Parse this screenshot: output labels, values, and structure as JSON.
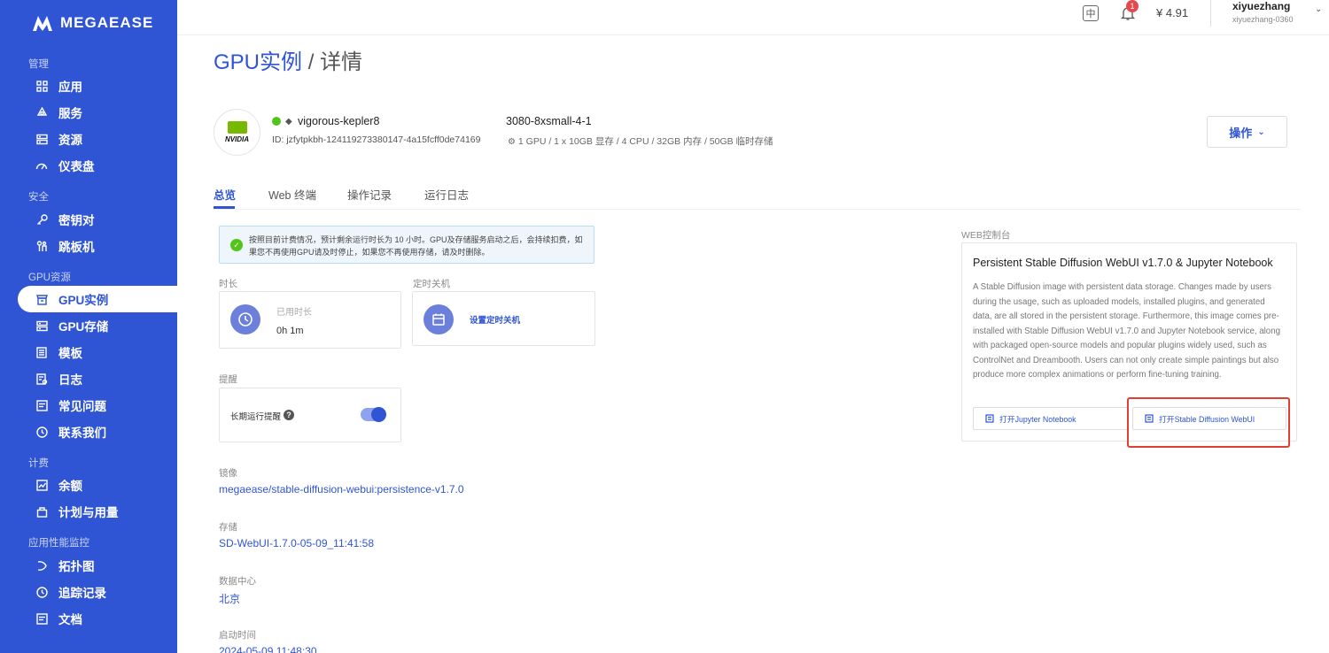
{
  "app": {
    "brand": "MEGAEASE"
  },
  "sidebar": {
    "sections": [
      {
        "title": "管理",
        "items": [
          {
            "label": "应用",
            "icon": "grid-icon"
          },
          {
            "label": "服务",
            "icon": "recycle-icon"
          },
          {
            "label": "资源",
            "icon": "server-icon"
          },
          {
            "label": "仪表盘",
            "icon": "gauge-icon"
          }
        ]
      },
      {
        "title": "安全",
        "items": [
          {
            "label": "密钥对",
            "icon": "key-icon"
          },
          {
            "label": "跳板机",
            "icon": "jump-icon"
          }
        ]
      },
      {
        "title": "GPU资源",
        "items": [
          {
            "label": "GPU实例",
            "icon": "gpu-icon",
            "active": true
          },
          {
            "label": "GPU存储",
            "icon": "storage-icon"
          },
          {
            "label": "模板",
            "icon": "template-icon"
          },
          {
            "label": "日志",
            "icon": "log-icon"
          },
          {
            "label": "常见问题",
            "icon": "faq-icon"
          },
          {
            "label": "联系我们",
            "icon": "clock-icon"
          }
        ]
      },
      {
        "title": "计费",
        "items": [
          {
            "label": "余额",
            "icon": "chart-icon"
          },
          {
            "label": "计划与用量",
            "icon": "bag-icon"
          }
        ]
      },
      {
        "title": "应用性能监控",
        "items": [
          {
            "label": "拓扑图",
            "icon": "topology-icon"
          },
          {
            "label": "追踪记录",
            "icon": "trace-icon"
          },
          {
            "label": "文档",
            "icon": "doc-icon"
          }
        ]
      }
    ]
  },
  "topbar": {
    "lang": "中",
    "notification_count": "1",
    "balance": "¥ 4.91",
    "username": "xiyuezhang",
    "user_id": "xiyuezhang-0360"
  },
  "breadcrumb": {
    "parent": "GPU实例",
    "separator": "/",
    "current": "详情"
  },
  "instance": {
    "vendor_logo": "NVIDIA",
    "name": "vigorous-kepler8",
    "id": "ID: jzfytpkbh-124119273380147-4a15fcff0de74169",
    "spec": "3080-8xsmall-4-1",
    "resources": "1 GPU / 1 x 10GB 显存 / 4 CPU / 32GB 内存 / 50GB 临时存储",
    "status_color": "#52c41a"
  },
  "actions": {
    "label": "操作"
  },
  "tabs": [
    "总览",
    "Web 终端",
    "操作记录",
    "运行日志"
  ],
  "notice": {
    "text": "按照目前计费情况，预计剩余运行时长为 10 小时。GPU及存储服务启动之后，会持续扣费，如果您不再使用GPU请及时停止，如果您不再使用存储，请及时删除。"
  },
  "duration": {
    "section": "时长",
    "used_label": "已用时长",
    "used_value": "0h 1m"
  },
  "schedule": {
    "section": "定时关机",
    "link": "设置定时关机"
  },
  "reminder": {
    "section": "提醒",
    "label": "长期运行提醒",
    "enabled": true
  },
  "details": [
    {
      "label": "镜像",
      "value": "megaease/stable-diffusion-webui:persistence-v1.7.0"
    },
    {
      "label": "存储",
      "value": "SD-WebUI-1.7.0-05-09_11:41:58"
    },
    {
      "label": "数据中心",
      "value": "北京"
    },
    {
      "label": "启动时间",
      "value": "2024-05-09 11:48:30"
    }
  ],
  "web_console": {
    "section": "WEB控制台",
    "title": "Persistent Stable Diffusion WebUI v1.7.0 & Jupyter Notebook",
    "description": "A Stable Diffusion image with persistent data storage. Changes made by users during the usage, such as uploaded models, installed plugins, and generated data, are all stored in the persistent storage. Furthermore, this image comes pre-installed with Stable Diffusion WebUI v1.7.0 and Jupyter Notebook service, along with packaged open-source models and popular plugins widely used, such as ControlNet and Dreambooth. Users can not only create simple paintings but also produce more complex animations or perform fine-tuning training.",
    "open_jupyter": "打开Jupyter Notebook",
    "open_sd": "打开Stable Diffusion WebUI"
  },
  "colors": {
    "brand": "#2f54d4",
    "highlight": "#e0402f",
    "success": "#52c41a"
  }
}
